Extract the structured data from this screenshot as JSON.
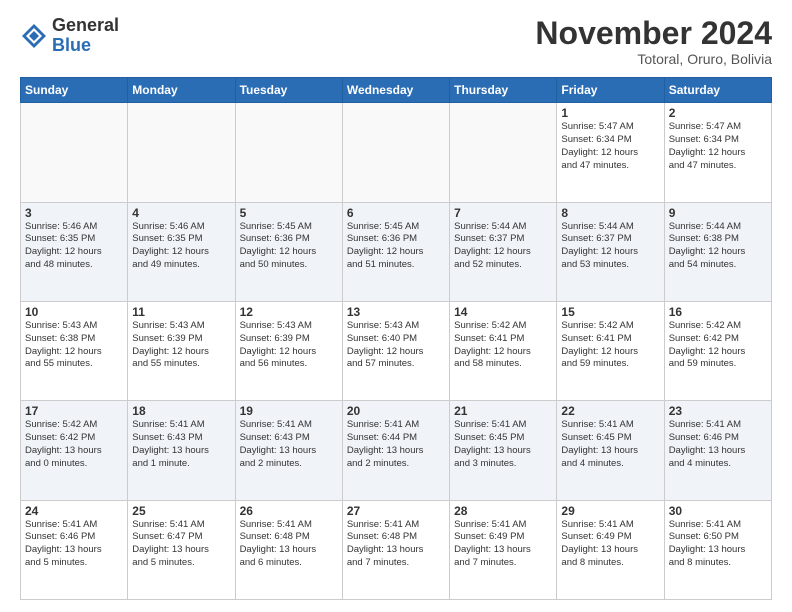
{
  "header": {
    "logo_general": "General",
    "logo_blue": "Blue",
    "month_title": "November 2024",
    "location": "Totoral, Oruro, Bolivia"
  },
  "weekdays": [
    "Sunday",
    "Monday",
    "Tuesday",
    "Wednesday",
    "Thursday",
    "Friday",
    "Saturday"
  ],
  "weeks": [
    [
      {
        "day": "",
        "info": ""
      },
      {
        "day": "",
        "info": ""
      },
      {
        "day": "",
        "info": ""
      },
      {
        "day": "",
        "info": ""
      },
      {
        "day": "",
        "info": ""
      },
      {
        "day": "1",
        "info": "Sunrise: 5:47 AM\nSunset: 6:34 PM\nDaylight: 12 hours\nand 47 minutes."
      },
      {
        "day": "2",
        "info": "Sunrise: 5:47 AM\nSunset: 6:34 PM\nDaylight: 12 hours\nand 47 minutes."
      }
    ],
    [
      {
        "day": "3",
        "info": "Sunrise: 5:46 AM\nSunset: 6:35 PM\nDaylight: 12 hours\nand 48 minutes."
      },
      {
        "day": "4",
        "info": "Sunrise: 5:46 AM\nSunset: 6:35 PM\nDaylight: 12 hours\nand 49 minutes."
      },
      {
        "day": "5",
        "info": "Sunrise: 5:45 AM\nSunset: 6:36 PM\nDaylight: 12 hours\nand 50 minutes."
      },
      {
        "day": "6",
        "info": "Sunrise: 5:45 AM\nSunset: 6:36 PM\nDaylight: 12 hours\nand 51 minutes."
      },
      {
        "day": "7",
        "info": "Sunrise: 5:44 AM\nSunset: 6:37 PM\nDaylight: 12 hours\nand 52 minutes."
      },
      {
        "day": "8",
        "info": "Sunrise: 5:44 AM\nSunset: 6:37 PM\nDaylight: 12 hours\nand 53 minutes."
      },
      {
        "day": "9",
        "info": "Sunrise: 5:44 AM\nSunset: 6:38 PM\nDaylight: 12 hours\nand 54 minutes."
      }
    ],
    [
      {
        "day": "10",
        "info": "Sunrise: 5:43 AM\nSunset: 6:38 PM\nDaylight: 12 hours\nand 55 minutes."
      },
      {
        "day": "11",
        "info": "Sunrise: 5:43 AM\nSunset: 6:39 PM\nDaylight: 12 hours\nand 55 minutes."
      },
      {
        "day": "12",
        "info": "Sunrise: 5:43 AM\nSunset: 6:39 PM\nDaylight: 12 hours\nand 56 minutes."
      },
      {
        "day": "13",
        "info": "Sunrise: 5:43 AM\nSunset: 6:40 PM\nDaylight: 12 hours\nand 57 minutes."
      },
      {
        "day": "14",
        "info": "Sunrise: 5:42 AM\nSunset: 6:41 PM\nDaylight: 12 hours\nand 58 minutes."
      },
      {
        "day": "15",
        "info": "Sunrise: 5:42 AM\nSunset: 6:41 PM\nDaylight: 12 hours\nand 59 minutes."
      },
      {
        "day": "16",
        "info": "Sunrise: 5:42 AM\nSunset: 6:42 PM\nDaylight: 12 hours\nand 59 minutes."
      }
    ],
    [
      {
        "day": "17",
        "info": "Sunrise: 5:42 AM\nSunset: 6:42 PM\nDaylight: 13 hours\nand 0 minutes."
      },
      {
        "day": "18",
        "info": "Sunrise: 5:41 AM\nSunset: 6:43 PM\nDaylight: 13 hours\nand 1 minute."
      },
      {
        "day": "19",
        "info": "Sunrise: 5:41 AM\nSunset: 6:43 PM\nDaylight: 13 hours\nand 2 minutes."
      },
      {
        "day": "20",
        "info": "Sunrise: 5:41 AM\nSunset: 6:44 PM\nDaylight: 13 hours\nand 2 minutes."
      },
      {
        "day": "21",
        "info": "Sunrise: 5:41 AM\nSunset: 6:45 PM\nDaylight: 13 hours\nand 3 minutes."
      },
      {
        "day": "22",
        "info": "Sunrise: 5:41 AM\nSunset: 6:45 PM\nDaylight: 13 hours\nand 4 minutes."
      },
      {
        "day": "23",
        "info": "Sunrise: 5:41 AM\nSunset: 6:46 PM\nDaylight: 13 hours\nand 4 minutes."
      }
    ],
    [
      {
        "day": "24",
        "info": "Sunrise: 5:41 AM\nSunset: 6:46 PM\nDaylight: 13 hours\nand 5 minutes."
      },
      {
        "day": "25",
        "info": "Sunrise: 5:41 AM\nSunset: 6:47 PM\nDaylight: 13 hours\nand 5 minutes."
      },
      {
        "day": "26",
        "info": "Sunrise: 5:41 AM\nSunset: 6:48 PM\nDaylight: 13 hours\nand 6 minutes."
      },
      {
        "day": "27",
        "info": "Sunrise: 5:41 AM\nSunset: 6:48 PM\nDaylight: 13 hours\nand 7 minutes."
      },
      {
        "day": "28",
        "info": "Sunrise: 5:41 AM\nSunset: 6:49 PM\nDaylight: 13 hours\nand 7 minutes."
      },
      {
        "day": "29",
        "info": "Sunrise: 5:41 AM\nSunset: 6:49 PM\nDaylight: 13 hours\nand 8 minutes."
      },
      {
        "day": "30",
        "info": "Sunrise: 5:41 AM\nSunset: 6:50 PM\nDaylight: 13 hours\nand 8 minutes."
      }
    ]
  ]
}
